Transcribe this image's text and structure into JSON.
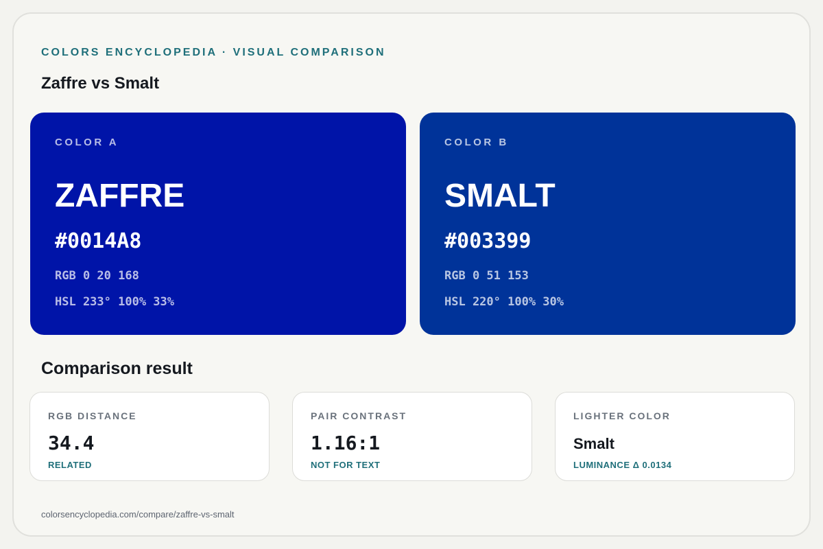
{
  "header": {
    "eyebrow": "COLORS ENCYCLOPEDIA · VISUAL COMPARISON",
    "title": "Zaffre vs Smalt"
  },
  "colors": {
    "a": {
      "label": "COLOR A",
      "name": "ZAFFRE",
      "hex": "#0014A8",
      "rgb": "RGB 0 20 168",
      "hsl": "HSL 233° 100% 33%",
      "swatch_color": "#0014a8"
    },
    "b": {
      "label": "COLOR B",
      "name": "SMALT",
      "hex": "#003399",
      "rgb": "RGB 0 51 153",
      "hsl": "HSL 220° 100% 30%",
      "swatch_color": "#003399"
    }
  },
  "comparison": {
    "title": "Comparison result",
    "metrics": [
      {
        "label": "RGB DISTANCE",
        "value": "34.4",
        "note": "RELATED"
      },
      {
        "label": "PAIR CONTRAST",
        "value": "1.16:1",
        "note": "NOT FOR TEXT"
      },
      {
        "label": "LIGHTER COLOR",
        "value": "Smalt",
        "note": "LUMINANCE Δ 0.0134"
      }
    ]
  },
  "footer": {
    "url": "colorsencyclopedia.com/compare/zaffre-vs-smalt"
  },
  "theme": {
    "accent": "#1f6f7a",
    "text_dark": "#15191f",
    "muted": "#6a727c"
  }
}
